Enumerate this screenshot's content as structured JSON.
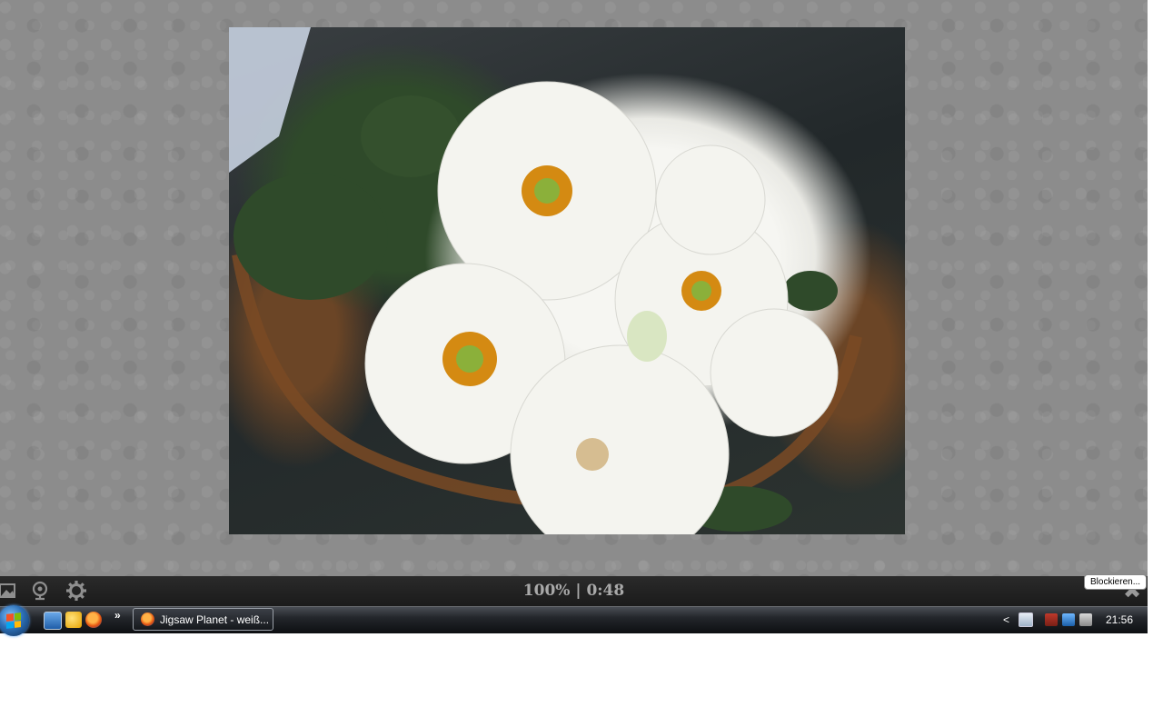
{
  "board": {
    "photo_alt": "White primrose flowers in a wicker basket"
  },
  "controls": {
    "status": "100% | 0:48",
    "icons": [
      "picture-icon",
      "pieces-icon",
      "settings-icon",
      "close-icon"
    ],
    "tooltip": "Blockieren..."
  },
  "taskbar": {
    "quick_launch": [
      "show-desktop-icon",
      "mail-icon",
      "firefox-icon"
    ],
    "overflow": "»",
    "task_label": "Jigsaw Planet - weiß...",
    "tray_arrow": "<",
    "clock": "21:56"
  }
}
